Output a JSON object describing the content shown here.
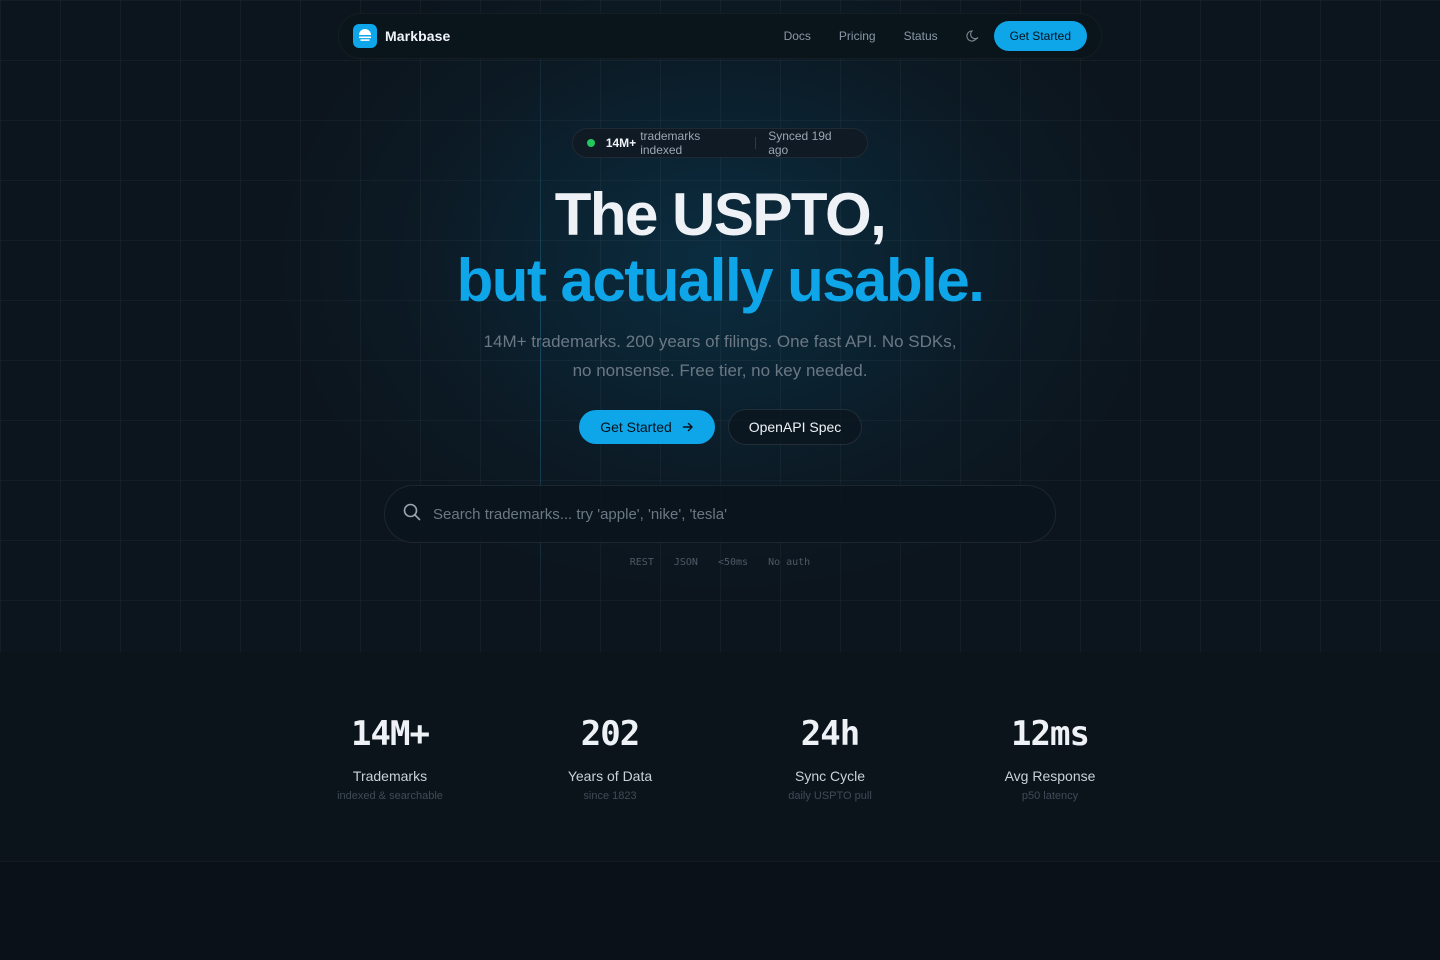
{
  "nav": {
    "brand": "Markbase",
    "links": [
      {
        "label": "Docs"
      },
      {
        "label": "Pricing"
      },
      {
        "label": "Status"
      }
    ],
    "theme_icon": "moon-icon",
    "cta": "Get Started"
  },
  "badge": {
    "count": "14M+",
    "text": "trademarks indexed",
    "synced": "Synced 19d ago",
    "status_color": "#22c55e"
  },
  "hero": {
    "headline_line1": "The USPTO,",
    "headline_line2": "but actually usable.",
    "subhead_line1": "14M+ trademarks. 200 years of filings. One fast API. No SDKs,",
    "subhead_line2": "no nonsense. Free tier, no key needed.",
    "primary_cta": "Get Started",
    "secondary_cta": "OpenAPI Spec"
  },
  "search": {
    "placeholder": "Search trademarks... try 'apple', 'nike', 'tesla'",
    "value": ""
  },
  "tags": [
    "REST",
    "JSON",
    "<50ms",
    "No auth"
  ],
  "stats": [
    {
      "value": "14M+",
      "label": "Trademarks",
      "note": "indexed & searchable"
    },
    {
      "value": "202",
      "label": "Years of Data",
      "note": "since 1823"
    },
    {
      "value": "24h",
      "label": "Sync Cycle",
      "note": "daily USPTO pull"
    },
    {
      "value": "12ms",
      "label": "Avg Response",
      "note": "p50 latency"
    }
  ],
  "colors": {
    "accent": "#0ea5e9",
    "background": "#0b1219",
    "text": "#eef2f6"
  }
}
